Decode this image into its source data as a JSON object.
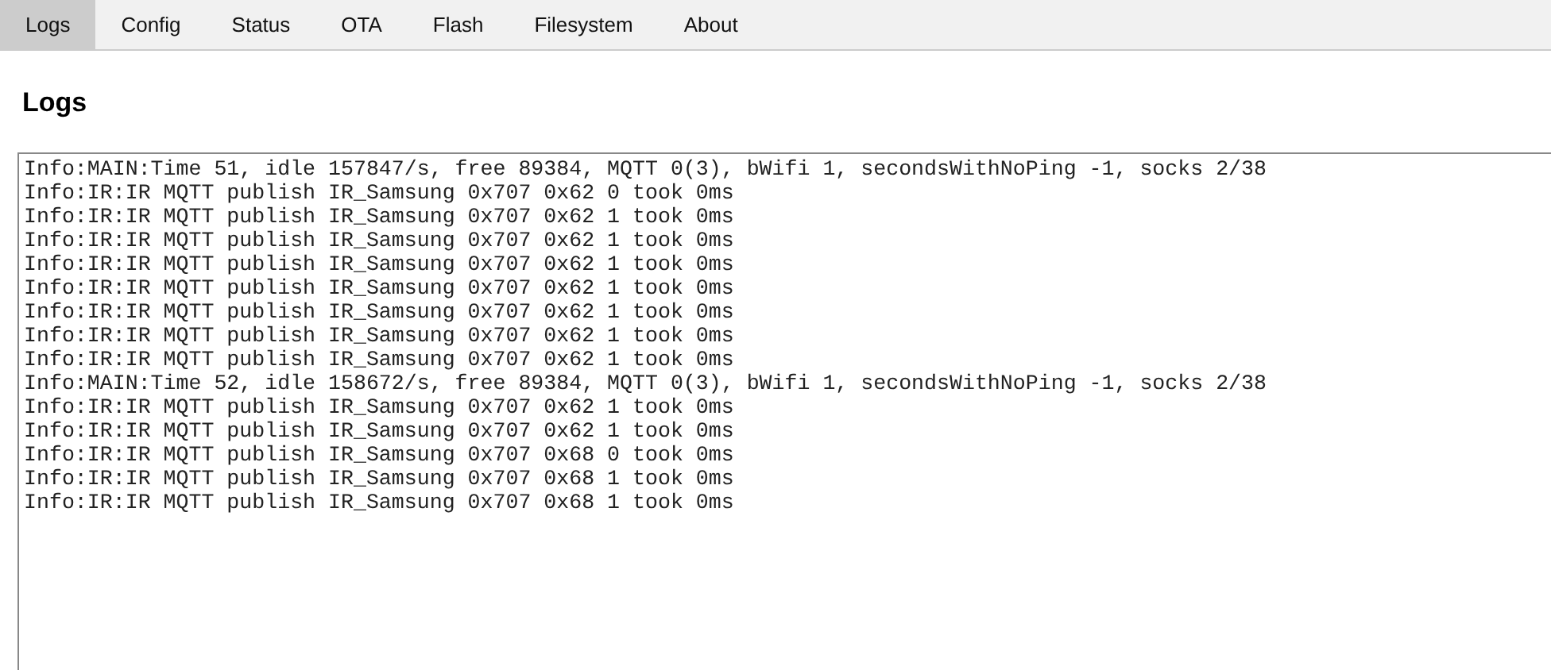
{
  "tabs": [
    {
      "label": "Logs",
      "selected": true
    },
    {
      "label": "Config",
      "selected": false
    },
    {
      "label": "Status",
      "selected": false
    },
    {
      "label": "OTA",
      "selected": false
    },
    {
      "label": "Flash",
      "selected": false
    },
    {
      "label": "Filesystem",
      "selected": false
    },
    {
      "label": "About",
      "selected": false
    }
  ],
  "heading": "Logs",
  "log_lines": [
    "Info:MAIN:Time 51, idle 157847/s, free 89384, MQTT 0(3), bWifi 1, secondsWithNoPing -1, socks 2/38",
    "Info:IR:IR MQTT publish IR_Samsung 0x707 0x62 0 took 0ms",
    "Info:IR:IR MQTT publish IR_Samsung 0x707 0x62 1 took 0ms",
    "Info:IR:IR MQTT publish IR_Samsung 0x707 0x62 1 took 0ms",
    "Info:IR:IR MQTT publish IR_Samsung 0x707 0x62 1 took 0ms",
    "Info:IR:IR MQTT publish IR_Samsung 0x707 0x62 1 took 0ms",
    "Info:IR:IR MQTT publish IR_Samsung 0x707 0x62 1 took 0ms",
    "Info:IR:IR MQTT publish IR_Samsung 0x707 0x62 1 took 0ms",
    "Info:IR:IR MQTT publish IR_Samsung 0x707 0x62 1 took 0ms",
    "Info:MAIN:Time 52, idle 158672/s, free 89384, MQTT 0(3), bWifi 1, secondsWithNoPing -1, socks 2/38",
    "Info:IR:IR MQTT publish IR_Samsung 0x707 0x62 1 took 0ms",
    "Info:IR:IR MQTT publish IR_Samsung 0x707 0x62 1 took 0ms",
    "Info:IR:IR MQTT publish IR_Samsung 0x707 0x68 0 took 0ms",
    "Info:IR:IR MQTT publish IR_Samsung 0x707 0x68 1 took 0ms",
    "Info:IR:IR MQTT publish IR_Samsung 0x707 0x68 1 took 0ms"
  ]
}
